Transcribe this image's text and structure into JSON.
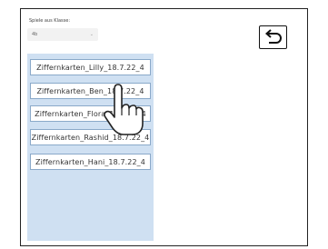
{
  "class_selector": {
    "label": "Spiele aus Klasse:",
    "value": "4b",
    "chevron": "⌄"
  },
  "back_button": {
    "icon": "undo-arrow-icon"
  },
  "games": [
    {
      "title": "Ziffernkarten_Lilly_18.7.22_4"
    },
    {
      "title": "Ziffernkarten_Ben_18.7.22_4"
    },
    {
      "title": "Ziffernkarten_Flora_18.7.22_4"
    },
    {
      "title": "Ziffernkarten_Rashid_18.7.22_4"
    },
    {
      "title": "Ziffernkarten_Hani_18.7.22_4"
    }
  ],
  "cursor": {
    "icon": "pointing-hand-icon"
  },
  "colors": {
    "panel": "#cfe0f2",
    "item_border": "#8aa9c9",
    "frame": "#222222"
  }
}
